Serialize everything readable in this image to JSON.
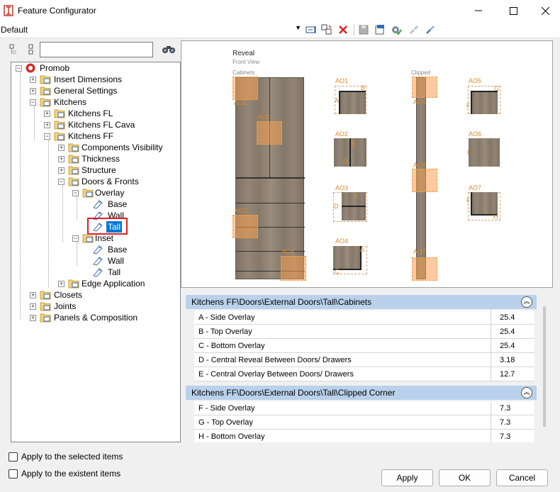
{
  "window": {
    "title": "Feature Configurator"
  },
  "toolbar": {
    "profile": "Default"
  },
  "tree": {
    "root": "Promob",
    "insert_dimensions": "Insert Dimensions",
    "general_settings": "General Settings",
    "kitchens": "Kitchens",
    "kitchens_fl": "Kitchens FL",
    "kitchens_fl_cava": "Kitchens FL Cava",
    "kitchens_ff": "Kitchens FF",
    "components_visibility": "Components Visibility",
    "thickness": "Thickness",
    "structure": "Structure",
    "doors_fronts": "Doors & Fronts",
    "overlay": "Overlay",
    "overlay_base": "Base",
    "overlay_wall": "Wall",
    "overlay_tall": "Tall",
    "inset": "Inset",
    "inset_base": "Base",
    "inset_wall": "Wall",
    "inset_tall": "Tall",
    "edge_application": "Edge Application",
    "closets": "Closets",
    "joints": "Joints",
    "panels": "Panels & Composition"
  },
  "preview": {
    "title": "Reveal",
    "subtitle": "Front View",
    "cabinets_label": "Cabinets",
    "clipped_label": "Clipped",
    "ao": [
      "AO1",
      "AO2",
      "AO3",
      "AO4",
      "AO5",
      "AO6",
      "AO7"
    ],
    "letters": [
      "A",
      "B",
      "C",
      "D",
      "E",
      "F",
      "G",
      "H"
    ]
  },
  "sections": [
    {
      "header": "Kitchens FF\\Doors\\External Doors\\Tall\\Cabinets",
      "rows": [
        {
          "label": "A - Side Overlay",
          "value": "25.4"
        },
        {
          "label": "B - Top Overlay",
          "value": "25.4"
        },
        {
          "label": "C - Bottom Overlay",
          "value": "25.4"
        },
        {
          "label": "D - Central Reveal Between Doors/ Drawers",
          "value": "3.18"
        },
        {
          "label": "E - Central Overlay Between Doors/ Drawers",
          "value": "12.7"
        }
      ]
    },
    {
      "header": "Kitchens FF\\Doors\\External Doors\\Tall\\Clipped Corner",
      "rows": [
        {
          "label": "F - Side Overlay",
          "value": "7.3"
        },
        {
          "label": "G - Top Overlay",
          "value": "7.3"
        },
        {
          "label": "H - Bottom Overlay",
          "value": "7.3"
        }
      ]
    }
  ],
  "options": {
    "apply_selected": "Apply to the selected items",
    "apply_existent": "Apply to the existent items"
  },
  "buttons": {
    "apply": "Apply",
    "ok": "OK",
    "cancel": "Cancel"
  }
}
